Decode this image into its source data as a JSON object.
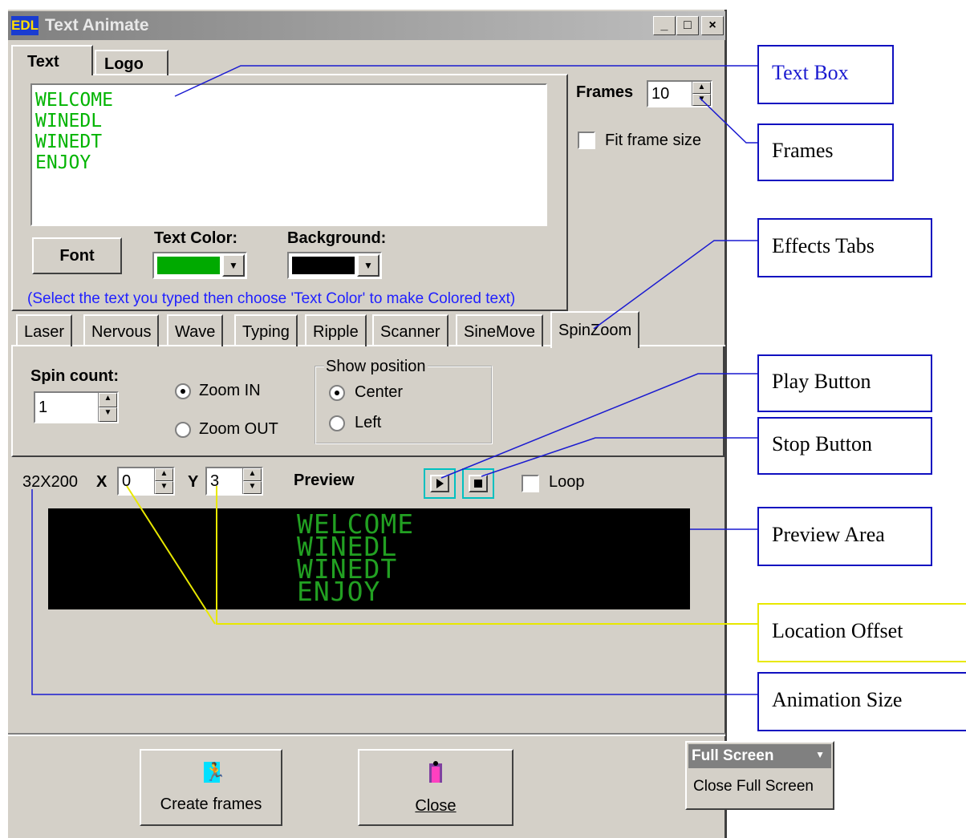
{
  "window": {
    "title": "Text Animate",
    "app_icon": "EDL",
    "minimize": "_",
    "maximize": "□",
    "close": "×"
  },
  "top_tabs": [
    "Text",
    "Logo"
  ],
  "text_panel": {
    "lines": [
      "WELCOME",
      "WINEDL",
      "WINEDT",
      "ENJOY"
    ],
    "font_button": "Font",
    "text_color_label": "Text Color:",
    "text_color": "#00aa00",
    "background_label": "Background:",
    "background_color": "#000000",
    "hint": "(Select the text you typed then choose 'Text Color' to make Colored text)"
  },
  "frames": {
    "label": "Frames",
    "value": "10",
    "fit_label": "Fit frame size",
    "fit_checked": false
  },
  "effect_tabs": [
    "Laser",
    "Nervous",
    "Wave",
    "Typing",
    "Ripple",
    "Scanner",
    "SineMove",
    "SpinZoom"
  ],
  "active_effect": "SpinZoom",
  "spinzoom": {
    "spin_count_label": "Spin count:",
    "spin_count": "1",
    "zoom_in": "Zoom IN",
    "zoom_out": "Zoom OUT",
    "zoom_selected": "Zoom IN",
    "show_position_label": "Show position",
    "center": "Center",
    "left": "Left",
    "position_selected": "Center"
  },
  "preview": {
    "size": "32X200",
    "x_label": "X",
    "x_value": "0",
    "y_label": "Y",
    "y_value": "3",
    "label": "Preview",
    "loop_label": "Loop",
    "loop_checked": false,
    "lines": [
      "WELCOME",
      "WINEDL",
      "WINEDT",
      "ENJOY"
    ]
  },
  "buttons": {
    "create_frames": "Create frames",
    "close": "Close"
  },
  "fullscreen_toolbar": {
    "title": "Full Screen",
    "close": "Close Full Screen"
  },
  "annotations": {
    "text_box": "Text Box",
    "frames": "Frames",
    "effects_tabs": "Effects Tabs",
    "play_button": "Play Button",
    "stop_button": "Stop Button",
    "preview_area": "Preview Area",
    "location_offset": "Location Offset",
    "animation_size": "Animation Size"
  },
  "colors": {
    "window_bg": "#d4d0c8",
    "annotation_blue": "#1010c0",
    "annotation_yellow": "#e8e800",
    "led_green": "#22a022"
  }
}
